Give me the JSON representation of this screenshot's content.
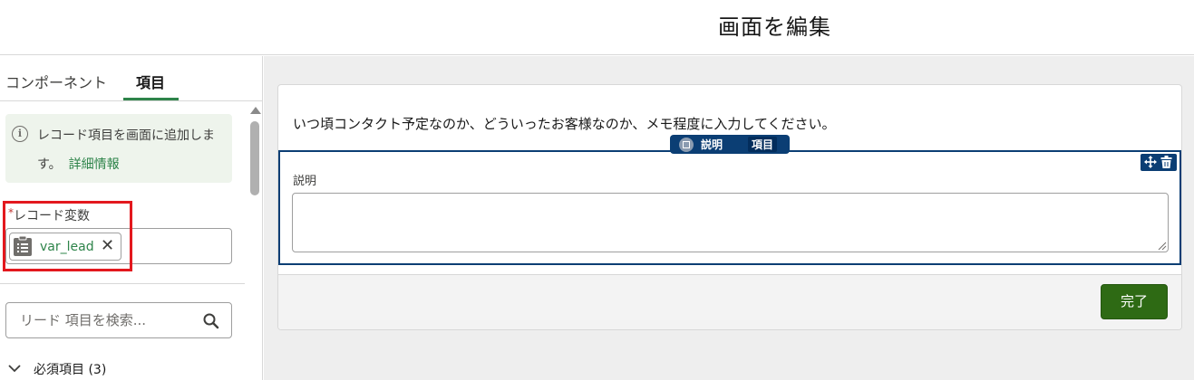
{
  "header": {
    "title": "画面を編集"
  },
  "left_panel": {
    "tabs": [
      {
        "label": "コンポーネント",
        "active": false
      },
      {
        "label": "項目",
        "active": true
      }
    ],
    "info": {
      "text": "レコード項目を画面に追加します。",
      "link": "詳細情報"
    },
    "record_variable": {
      "required_mark": "*",
      "label": "レコード変数",
      "value": "var_lead"
    },
    "search": {
      "placeholder": "リード 項目を検索..."
    },
    "required_fields": {
      "label": "必須項目 (3)"
    }
  },
  "canvas": {
    "instruction_text": "いつ頃コンタクト予定なのか、どういったお客様なのか、メモ程度に入力してください。",
    "component_tag": {
      "label": "説明",
      "type": "項目"
    },
    "field": {
      "label": "説明",
      "value": ""
    },
    "done_button": "完了"
  },
  "colors": {
    "accent_green": "#2e844a",
    "done_button": "#2e6a14",
    "selection_blue": "#0b3e74",
    "highlight_red": "#e3181e"
  }
}
